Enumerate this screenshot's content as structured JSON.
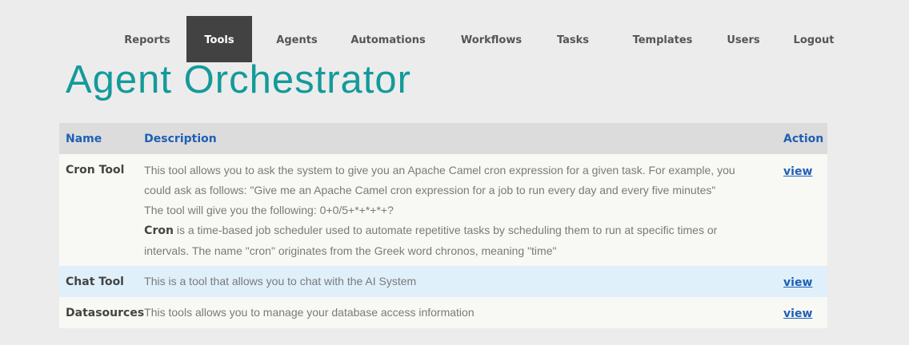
{
  "nav": {
    "items": [
      {
        "label": "Reports",
        "active": false
      },
      {
        "label": "Tools",
        "active": true
      },
      {
        "label": "Agents",
        "active": false
      },
      {
        "label": "Automations",
        "active": false
      },
      {
        "label": "Workflows",
        "active": false
      },
      {
        "label": "Tasks",
        "active": false
      },
      {
        "label": "Templates",
        "active": false
      },
      {
        "label": "Users",
        "active": false
      },
      {
        "label": "Logout",
        "active": false
      }
    ]
  },
  "page": {
    "title": "Agent Orchestrator"
  },
  "table": {
    "headers": {
      "name": "Name",
      "description": "Description",
      "action": "Action"
    },
    "rows": [
      {
        "name": "Cron Tool",
        "description_lines": [
          "This tool allows you to ask the system to give you an Apache Camel cron expression for a given task. For example, you",
          "could ask as follows: \"Give me an Apache Camel cron expression for a job to run every day and every five minutes\"",
          "The tool will give you the following: 0+0/5+*+*+*+?"
        ],
        "description_bold": "Cron",
        "description_rest_1": " is a time-based job scheduler used to automate repetitive tasks by scheduling them to run at specific times or",
        "description_rest_2": "intervals. The name \"cron\" originates from the Greek word chronos, meaning \"time\"",
        "action": "view"
      },
      {
        "name": "Chat Tool",
        "description": "This is a tool that allows you to chat with the AI System",
        "action": "view"
      },
      {
        "name": "Datasources",
        "description": "This tools allows you to manage your database access information",
        "action": "view"
      }
    ]
  },
  "colors": {
    "title": "#149a9a",
    "nav_active_bg": "#424242",
    "header_bg": "#dcdcdc",
    "link": "#1e5fb5",
    "row_highlight": "#dff0fb"
  }
}
